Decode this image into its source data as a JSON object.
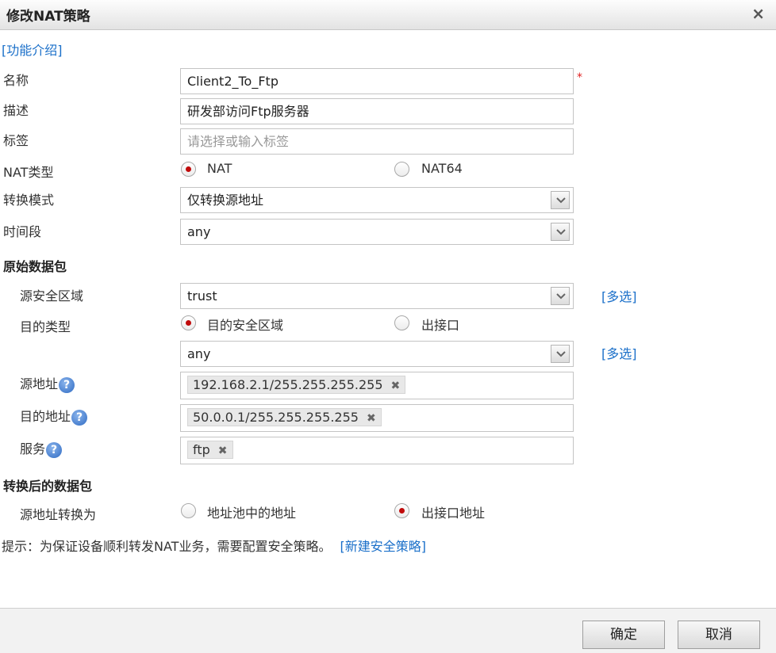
{
  "dialog": {
    "title": "修改NAT策略"
  },
  "intro_link": "[功能介绍]",
  "form": {
    "name": {
      "label": "名称",
      "value": "Client2_To_Ftp",
      "required_mark": "*"
    },
    "description": {
      "label": "描述",
      "value": "研发部访问Ftp服务器"
    },
    "tag": {
      "label": "标签",
      "placeholder": "请选择或输入标签"
    },
    "nat_type": {
      "label": "NAT类型",
      "options": [
        "NAT",
        "NAT64"
      ],
      "selected": "NAT"
    },
    "mode": {
      "label": "转换模式",
      "value": "仅转换源地址"
    },
    "schedule": {
      "label": "时间段",
      "value": "any"
    }
  },
  "original_packet": {
    "section_title": "原始数据包",
    "source_zone": {
      "label": "源安全区域",
      "value": "trust",
      "multi_link": "[多选]"
    },
    "dest_type": {
      "label": "目的类型",
      "options": [
        "目的安全区域",
        "出接口"
      ],
      "selected": "目的安全区域"
    },
    "dest_zone": {
      "value": "any",
      "multi_link": "[多选]"
    },
    "source_address": {
      "label": "源地址",
      "tags": [
        "192.168.2.1/255.255.255.255"
      ]
    },
    "dest_address": {
      "label": "目的地址",
      "tags": [
        "50.0.0.1/255.255.255.255"
      ]
    },
    "service": {
      "label": "服务",
      "tags": [
        "ftp"
      ]
    }
  },
  "translated_packet": {
    "section_title": "转换后的数据包",
    "source_translate": {
      "label": "源地址转换为",
      "options": [
        "地址池中的地址",
        "出接口地址"
      ],
      "selected": "出接口地址"
    }
  },
  "hint": {
    "text": "提示：为保证设备顺利转发NAT业务，需要配置安全策略。",
    "link": "[新建安全策略]"
  },
  "buttons": {
    "ok": "确定",
    "cancel": "取消"
  },
  "icons": {
    "close": "×",
    "help": "?",
    "tag_remove": "✖"
  }
}
